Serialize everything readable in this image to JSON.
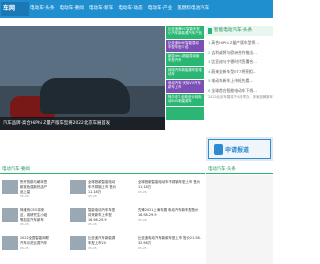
{
  "header": {
    "logo": "车网",
    "nav": [
      "电动车·头条",
      "电动车·要闻",
      "电动车·新车",
      "电动车·动态",
      "电动车·产业",
      "氢燃料电池汽车"
    ]
  },
  "hero": {
    "caption": "汽车品牌·高合HiPhi Z量产版车型将2022北京车展首发"
  },
  "side_menu": [
    {
      "label": "比亚迪牌VC智能车型小汽车新能源汽车产品",
      "color": "#2bb673"
    },
    {
      "label": "比亚迪BHE智能混动车型车型介绍",
      "color": "#7b4fb3"
    },
    {
      "label": "新蒙dm-i超级混动版车型汽车",
      "color": "#2bb673"
    },
    {
      "label": "纯电汽车新能源车型电动车",
      "color": "#2bb673"
    },
    {
      "label": "电动汽车·天际VV汽车新车上市",
      "color": "#7b4fb3"
    },
    {
      "label": "阿尔法T-全新设计纯电动SUV新能源车",
      "color": "#2bb673"
    },
    {
      "label": "",
      "color": "#2bb673"
    }
  ],
  "right_top": {
    "title": "智能电动汽车·头条",
    "items": [
      {
        "num": "1",
        "text": "高合HiPhi Z量产版车型将…"
      },
      {
        "num": "2",
        "text": "吉利或将与欧洲合作推出…"
      },
      {
        "num": "3",
        "text": "比亚迪与宁德时代签署合…"
      },
      {
        "num": "4",
        "text": "蔚来全新车型ET7将亮相…"
      },
      {
        "num": "5",
        "text": "电动车新车上市抢先看…"
      },
      {
        "num": "6",
        "text": "全球首台智能电动车下线…"
      }
    ],
    "grey": "2022北京车展将于4月举办，多家品牌新车亮相，新能源车型成为焦点…"
  },
  "banner": {
    "text": "申请报道"
  },
  "section_left": {
    "title": "电动汽车·要闻"
  },
  "section_right": {
    "title": "电动汽车·头条"
  },
  "news": [
    {
      "col": 0,
      "rows": [
        {
          "title": "所开的那与朝本签新准色强新热活产品上量",
          "meta": "05-26"
        },
        {
          "title": "阿维有CEO将来这，用研究生小组等加定汽车新车",
          "meta": "05-26"
        },
        {
          "title": "2022全国智能网联汽车示范比赛汽车",
          "meta": "05-25"
        }
      ]
    },
    {
      "col": 1,
      "rows": [
        {
          "title": "全球首款智能电动车不锈钢上市 售价11.18万",
          "meta": "05-26"
        },
        {
          "title": "智能电动汽车车型将来新车上车型 16.98-29.9",
          "meta": "05-26"
        },
        {
          "title": "比亚迪汽车新能源车型上市20",
          "meta": "05-25"
        }
      ]
    },
    {
      "col": 2,
      "rows": [
        {
          "title": "全球首款智能电动车不锈钢车型上市 售价11.18万",
          "meta": "05-26"
        },
        {
          "title": "先锋2021上海车展 电动汽车新车型售价16.98-29.9",
          "meta": "05-26"
        },
        {
          "title": "比亚迪电动汽车新款车型上市 售价21.58-32.98万",
          "meta": "05-25"
        }
      ]
    }
  ],
  "thumb_caps": [
    "汽车品牌车型图",
    "新能源汽车图",
    "电动汽车图片"
  ]
}
